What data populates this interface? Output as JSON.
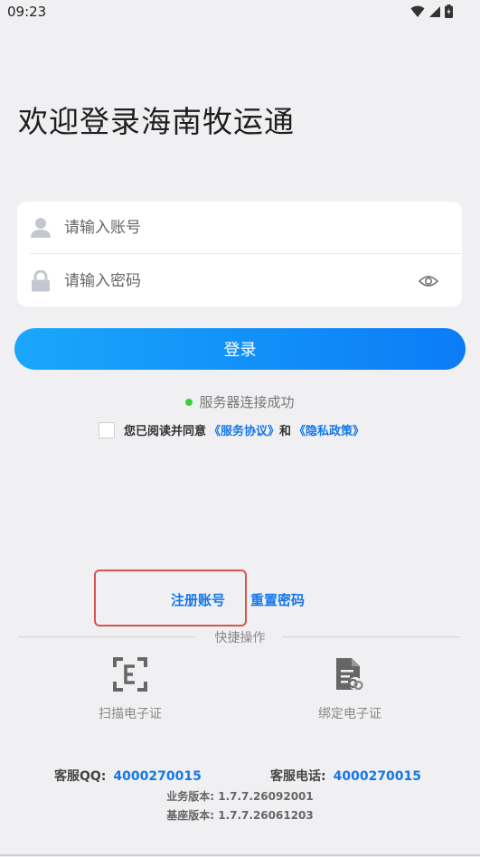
{
  "status_bar": {
    "time": "09:23"
  },
  "welcome": {
    "title": "欢迎登录海南牧运通"
  },
  "login_form": {
    "account_placeholder": "请输入账号",
    "password_placeholder": "请输入密码",
    "login_label": "登录"
  },
  "server": {
    "status_text": "服务器连接成功",
    "status_color": "#39d23a"
  },
  "agreement": {
    "prefix": "您已阅读并同意",
    "service_link": "《服务协议》",
    "conjunction": "和",
    "privacy_link": "《隐私政策》",
    "checked": false
  },
  "account_links": {
    "register": "注册账号",
    "reset_password": "重置密码"
  },
  "shortcuts": {
    "title": "快捷操作",
    "items": [
      {
        "label": "扫描电子证",
        "icon": "scan-certificate-icon"
      },
      {
        "label": "绑定电子证",
        "icon": "bind-certificate-icon"
      }
    ]
  },
  "contact": {
    "qq_label": "客服QQ:",
    "qq_value": "4000270015",
    "phone_label": "客服电话:",
    "phone_value": "4000270015"
  },
  "versions": {
    "business": "业务版本: 1.7.7.26092001",
    "base": "基座版本: 1.7.7.26061203"
  },
  "colors": {
    "accent": "#1677e8",
    "button_gradient_start": "#1aa7fb",
    "button_gradient_end": "#0b7cf6",
    "highlight_box": "#d9534f"
  }
}
